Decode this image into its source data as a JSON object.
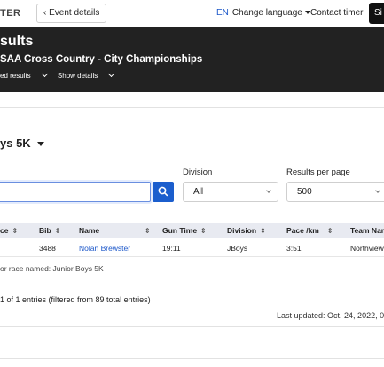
{
  "nav": {
    "brand": "TER",
    "back_label": "Event details",
    "lang_code": "EN",
    "lang_label": "Change language",
    "contact_label": "Contact timer",
    "signin_label": "Si"
  },
  "header": {
    "title": "sults",
    "subtitle": "SAA Cross Country - City Championships",
    "links": [
      "ed results",
      "Show details"
    ]
  },
  "race_selector": {
    "label": "ys 5K"
  },
  "filters": {
    "division_label": "Division",
    "division_value": "All",
    "per_page_label": "Results per page",
    "per_page_value": "500",
    "search_value": ""
  },
  "table": {
    "columns": [
      "ce",
      "Bib",
      "Name",
      "Gun Time",
      "Division",
      "Pace /km",
      "Team Nam"
    ],
    "rows": [
      {
        "place": "",
        "bib": "3488",
        "name": "Nolan Brewster",
        "gun_time": "19:11",
        "division": "JBoys",
        "pace": "3:51",
        "team": "Northview"
      }
    ]
  },
  "race_note": "or race named: Junior Boys 5K",
  "entries_summary": "1 of 1 entries (filtered from 89 total entries)",
  "last_updated": "Last updated: Oct. 24, 2022, 02:"
}
